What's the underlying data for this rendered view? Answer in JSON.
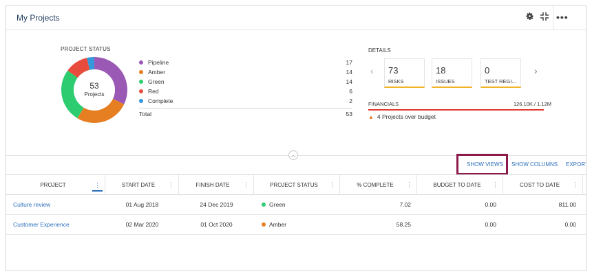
{
  "panel": {
    "title": "My Projects"
  },
  "header_icons": {
    "settings": "gear-icon",
    "collapse": "compress-icon",
    "more": "more-icon"
  },
  "project_status": {
    "label": "PROJECT STATUS",
    "center_number": "53",
    "center_label": "Projects",
    "items": [
      {
        "name": "Pipeline",
        "value": "17",
        "color": "#9b59b6"
      },
      {
        "name": "Amber",
        "value": "14",
        "color": "#e67e22"
      },
      {
        "name": "Green",
        "value": "14",
        "color": "#2ecc71"
      },
      {
        "name": "Red",
        "value": "6",
        "color": "#e74c3c"
      },
      {
        "name": "Complete",
        "value": "2",
        "color": "#3498db"
      }
    ],
    "total_label": "Total",
    "total_value": "53"
  },
  "details": {
    "label": "DETAILS",
    "cards": [
      {
        "value": "73",
        "label": "RISKS"
      },
      {
        "value": "18",
        "label": "ISSUES"
      },
      {
        "value": "0",
        "label": "TEST REGI..."
      }
    ],
    "financials_label": "FINANCIALS",
    "financials_value": "126.10K / 1.12M",
    "warning": "4 Projects over budget"
  },
  "toolbar": {
    "show_views": "SHOW VIEWS",
    "show_columns": "SHOW COLUMNS",
    "export": "EXPORT"
  },
  "table": {
    "columns": [
      "PROJECT",
      "START DATE",
      "FINISH DATE",
      "PROJECT STATUS",
      "% COMPLETE",
      "BUDGET TO DATE",
      "COST TO DATE"
    ],
    "rows": [
      {
        "project": "Culture review",
        "start": "01 Aug 2018",
        "finish": "24 Dec 2019",
        "status": "Green",
        "status_color": "#2ecc71",
        "complete": "7.02",
        "budget": "0.00",
        "cost": "811.00"
      },
      {
        "project": "Customer Experience",
        "start": "02 Mar 2020",
        "finish": "01 Oct 2020",
        "status": "Amber",
        "status_color": "#e67e22",
        "complete": "58.25",
        "budget": "0.00",
        "cost": "0.00"
      }
    ]
  }
}
